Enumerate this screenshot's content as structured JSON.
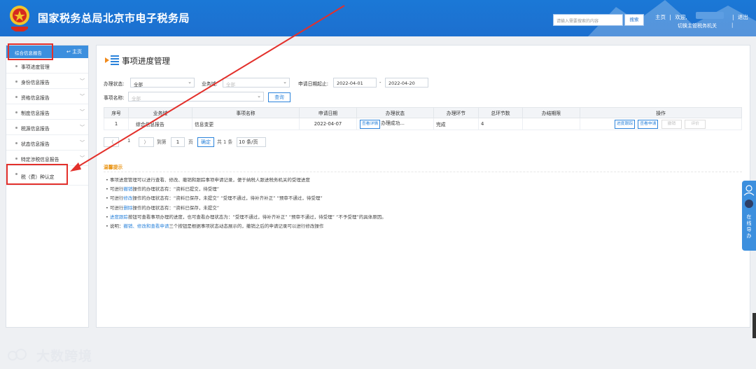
{
  "header": {
    "site_name": "国家税务总局北京市电子税务局",
    "search_placeholder": "请输入需要搜索的内容",
    "search_button": "搜索",
    "home_link": "主页",
    "separator": "|",
    "welcome": "欢迎,",
    "logout": "退出",
    "switch_agency": "切换主管税务机关",
    "emblem_caption": "中国税务",
    "colors": {
      "bar": "#1c6fcf",
      "accent": "#2d84db",
      "highlight": "#e3302b"
    }
  },
  "sidebar": {
    "top_title": "综合信息报告",
    "home": "主页",
    "items": [
      {
        "label": "事项进度管理",
        "chevron": ""
      },
      {
        "label": "身份信息报告",
        "chevron": "﹀"
      },
      {
        "label": "资格信息报告",
        "chevron": "﹀"
      },
      {
        "label": "制度信息报告",
        "chevron": "﹀"
      },
      {
        "label": "税源信息报告",
        "chevron": "﹀"
      },
      {
        "label": "状态信息报告",
        "chevron": "﹀"
      },
      {
        "label": "特定涉税信息报告",
        "chevron": "﹀"
      },
      {
        "label": "税（费）种认定",
        "chevron": ""
      }
    ]
  },
  "main": {
    "title": "事项进度管理",
    "filters": {
      "status_label": "办理状态:",
      "status_value": "全部",
      "business_label": "业务域:",
      "business_value": "全部",
      "date_label": "申请日期起止:",
      "date_from": "2022-04-01",
      "date_sep": "-",
      "date_to": "2022-04-20",
      "item_label": "事项名称:",
      "item_value": "全部",
      "query_button": "查询"
    },
    "table": {
      "headers": [
        "序号",
        "业务域",
        "事项名称",
        "申请日期",
        "办理状态",
        "办理环节",
        "总环节数",
        "办结期限",
        "操作"
      ],
      "rows": [
        {
          "no": "1",
          "domain": "综合信息报告",
          "item": "信息变更",
          "date": "2022-04-07",
          "status_btn": "查看详情",
          "status": "办理成功...",
          "stage": "完成",
          "total": "4",
          "deadline": "",
          "ops": [
            "进度跟踪",
            "查看申请",
            "撤销",
            "评价"
          ]
        }
      ]
    },
    "pagination": {
      "prev": "〈",
      "page": "1",
      "next": "〉",
      "goto_label": "到第",
      "goto_value": "1",
      "page_unit": "页",
      "confirm": "确定",
      "total": "共 1 条",
      "page_size": "10 条/页"
    },
    "tips": {
      "title": "温馨提示",
      "lines": [
        [
          "• 事项进度管理可以进行查看、修改、撤销和跟踪事项申请记录，便于纳税人跟进税务机关的受理进度",
          "",
          ""
        ],
        [
          "• 可进行",
          "撤销",
          "操作的办理状态有：“资料已提交，待受理”"
        ],
        [
          "• 可进行",
          "修改",
          "操作的办理状态有：“资料已保存，未提交”  “受理不通过，待补齐补正”  “预审不通过，待受理”"
        ],
        [
          "• 可进行",
          "删除",
          "操作的办理状态有：“资料已保存，未提交”"
        ],
        [
          "• ",
          "进度跟踪",
          "按钮可查看事项办理的进度，也可查看办理状态为：“受理不通过，待补齐补正”  “预审不通过，待受理”  “不予受理”的具体原因。"
        ],
        [
          "• 说明：",
          "撤销、修改和查看申请",
          "三个按钮是根据事项状态动态展示的，撤销之后的申请记录可以进行修改操作"
        ]
      ]
    }
  },
  "float_tab": {
    "label": "在线导办"
  },
  "watermark": {
    "text": "大数跨境"
  }
}
